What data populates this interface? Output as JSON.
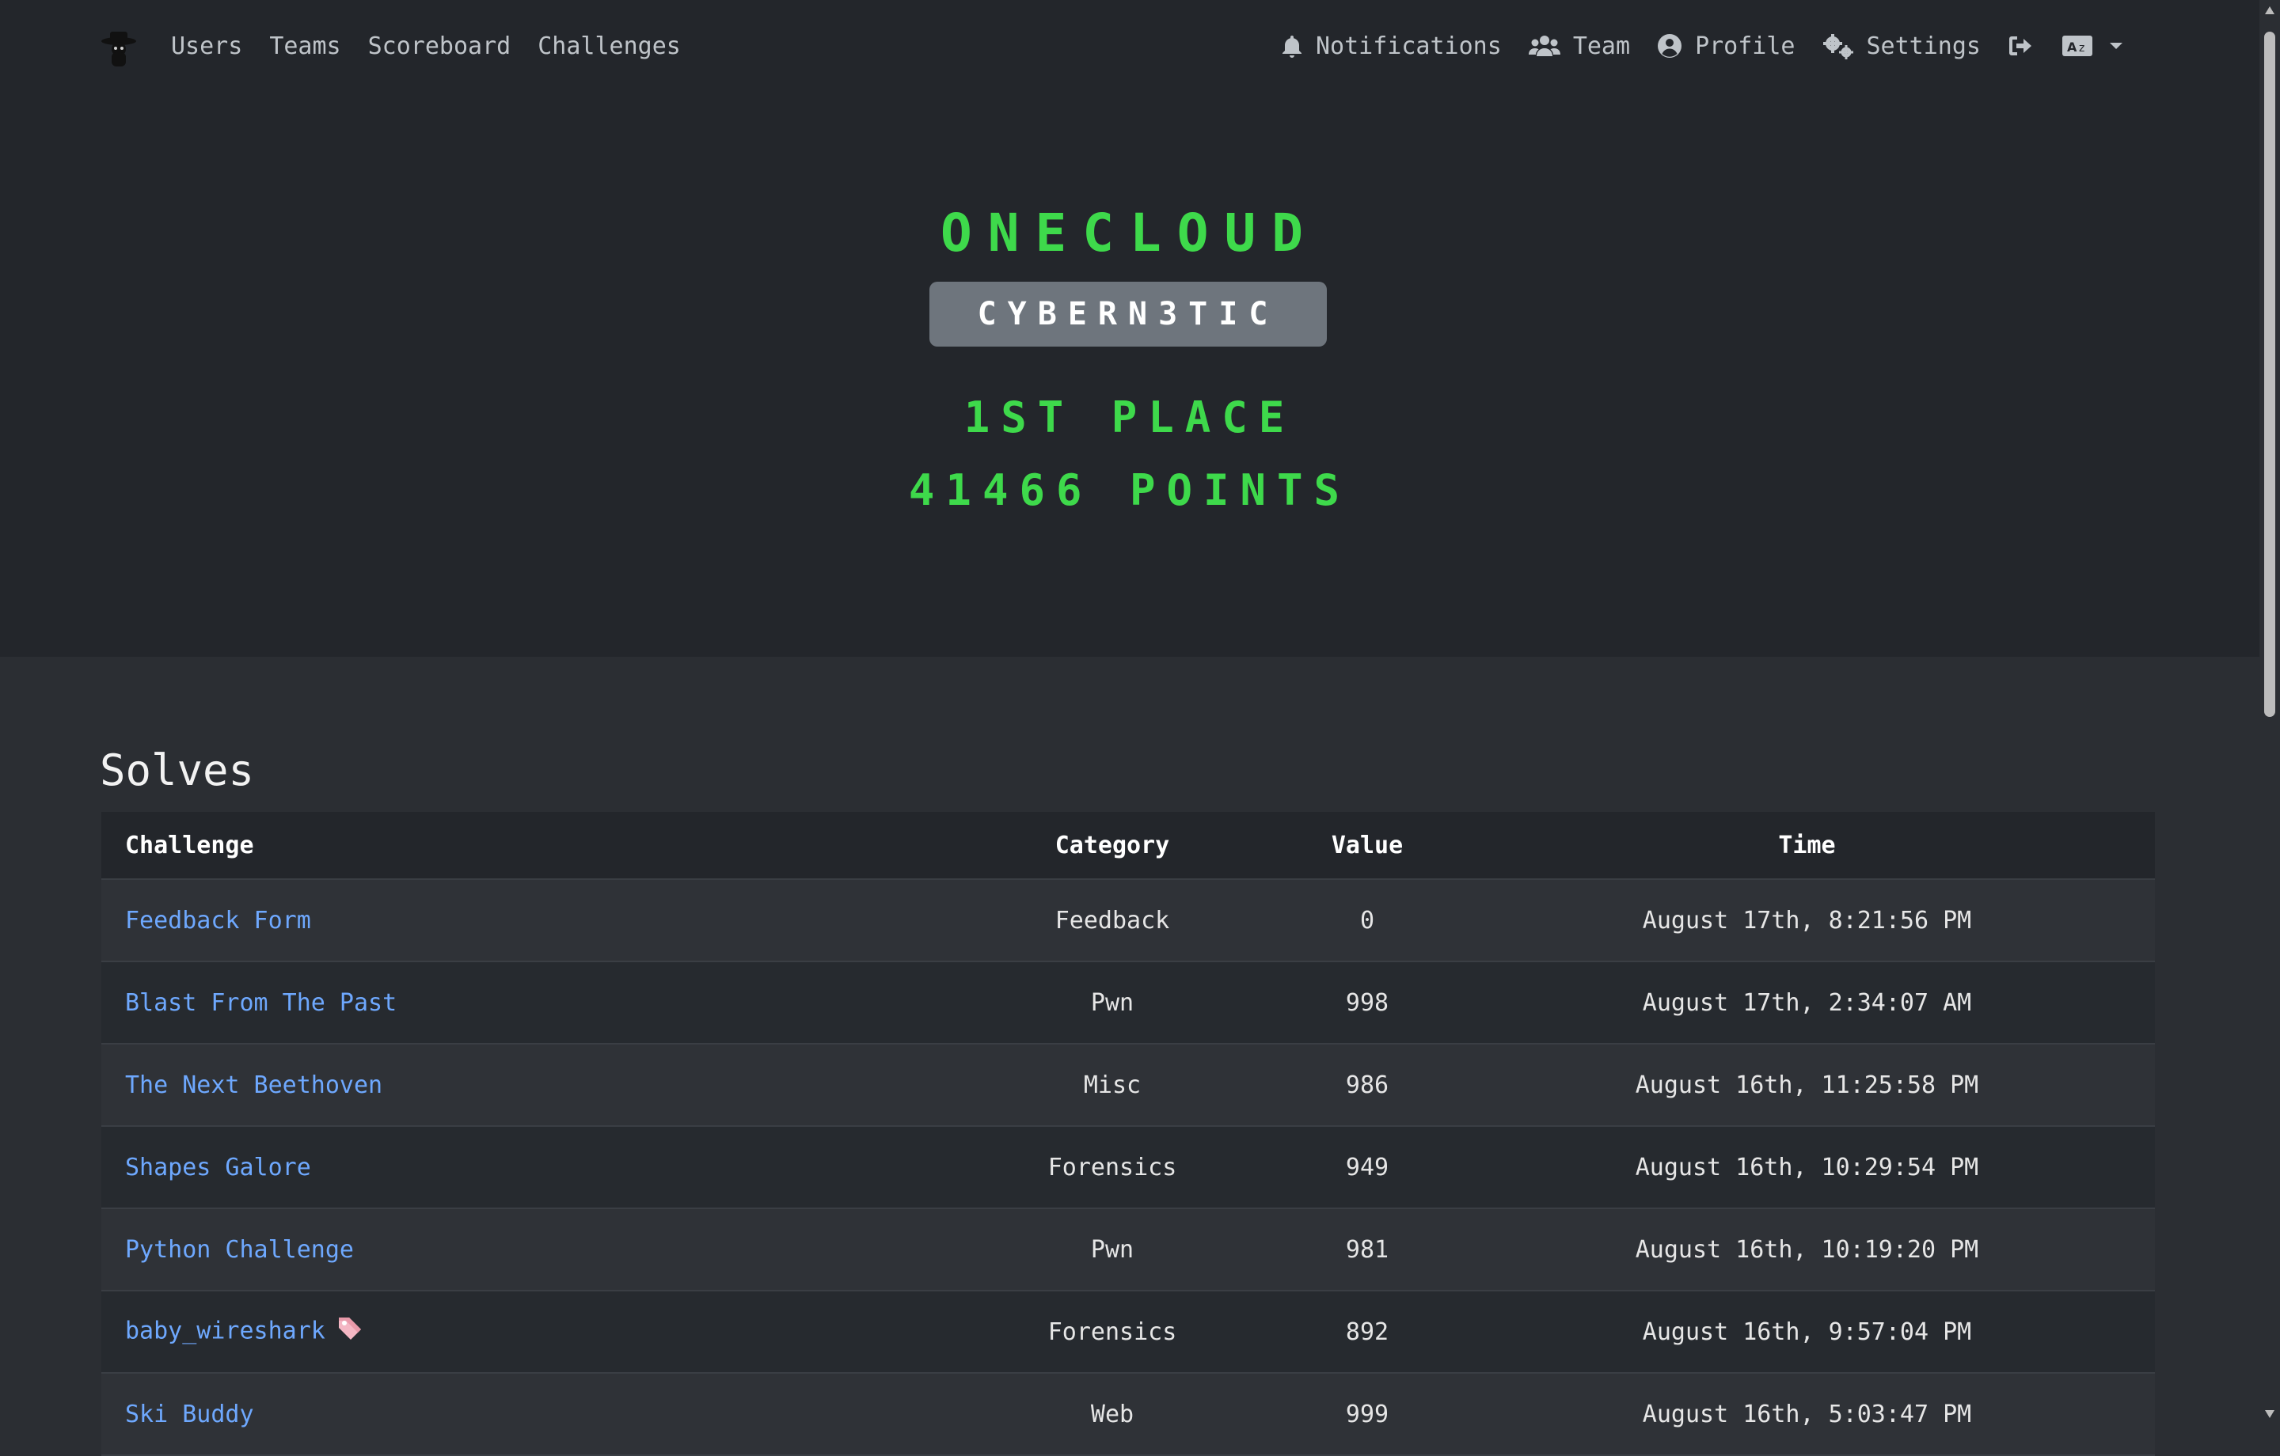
{
  "nav": {
    "left": [
      "Users",
      "Teams",
      "Scoreboard",
      "Challenges"
    ],
    "notifications": "Notifications",
    "team": "Team",
    "profile": "Profile",
    "settings": "Settings"
  },
  "hero": {
    "team_name": "ONECLOUD",
    "affiliation": "CYBERN3TIC",
    "place": "1ST PLACE",
    "points": "41466 POINTS"
  },
  "solves": {
    "title": "Solves",
    "headers": [
      "Challenge",
      "Category",
      "Value",
      "Time"
    ],
    "rows": [
      {
        "challenge": "Feedback Form",
        "category": "Feedback",
        "value": "0",
        "time": "August 17th, 8:21:56 PM"
      },
      {
        "challenge": "Blast From The Past",
        "category": "Pwn",
        "value": "998",
        "time": "August 17th, 2:34:07 AM"
      },
      {
        "challenge": "The Next Beethoven",
        "category": "Misc",
        "value": "986",
        "time": "August 16th, 11:25:58 PM"
      },
      {
        "challenge": "Shapes Galore",
        "category": "Forensics",
        "value": "949",
        "time": "August 16th, 10:29:54 PM"
      },
      {
        "challenge": "Python Challenge",
        "category": "Pwn",
        "value": "981",
        "time": "August 16th, 10:19:20 PM"
      },
      {
        "challenge": "baby_wireshark",
        "category": "Forensics",
        "value": "892",
        "time": "August 16th, 9:57:04 PM",
        "icon": "tag-icon"
      },
      {
        "challenge": "Ski Buddy",
        "category": "Web",
        "value": "999",
        "time": "August 16th, 5:03:47 PM"
      }
    ]
  },
  "colors": {
    "accent_green": "#3ed94b",
    "link_blue": "#6ea8fe",
    "badge_gray": "#6e757d",
    "background": "#2b2e33",
    "navbar": "#23262b"
  }
}
